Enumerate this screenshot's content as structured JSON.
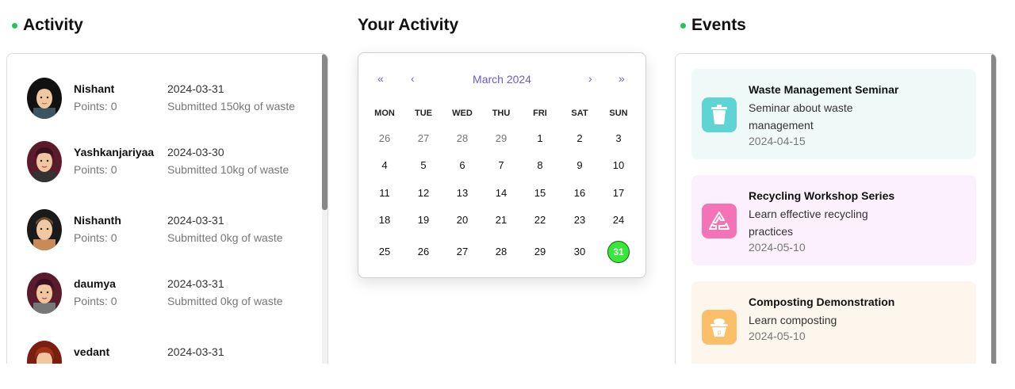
{
  "activity": {
    "title": "Activity",
    "items": [
      {
        "name": "Nishant",
        "points": "Points: 0",
        "date": "2024-03-31",
        "desc": "Submitted 150kg of waste"
      },
      {
        "name": "Yashkanjariyaa",
        "points": "Points: 0",
        "date": "2024-03-30",
        "desc": "Submitted 10kg of waste"
      },
      {
        "name": "Nishanth",
        "points": "Points: 0",
        "date": "2024-03-31",
        "desc": "Submitted 0kg of waste"
      },
      {
        "name": "daumya",
        "points": "Points: 0",
        "date": "2024-03-31",
        "desc": "Submitted 0kg of waste"
      },
      {
        "name": "vedant",
        "points": "",
        "date": "2024-03-31",
        "desc": ""
      }
    ]
  },
  "calendar": {
    "title": "Your Activity",
    "month_label": "March 2024",
    "nav": {
      "prev_year": "«",
      "prev_month": "‹",
      "next_month": "›",
      "next_year": "»"
    },
    "weekdays": [
      "MON",
      "TUE",
      "WED",
      "THU",
      "FRI",
      "SAT",
      "SUN"
    ],
    "weeks": [
      [
        "26",
        "27",
        "28",
        "29",
        "1",
        "2",
        "3"
      ],
      [
        "4",
        "5",
        "6",
        "7",
        "8",
        "9",
        "10"
      ],
      [
        "11",
        "12",
        "13",
        "14",
        "15",
        "16",
        "17"
      ],
      [
        "18",
        "19",
        "20",
        "21",
        "22",
        "23",
        "24"
      ],
      [
        "25",
        "26",
        "27",
        "28",
        "29",
        "30",
        "31"
      ]
    ],
    "selected_day": "31",
    "accent_color": "#6a5acd",
    "today_color": "#39e639"
  },
  "events": {
    "title": "Events",
    "items": [
      {
        "title": "Waste Management Seminar",
        "desc": "Seminar about waste management",
        "date": "2024-04-15",
        "icon": "trash-bin-icon",
        "bg": "#effaf8",
        "icon_bg": "#5fd4d4"
      },
      {
        "title": "Recycling Workshop Series",
        "desc": "Learn effective recycling practices",
        "date": "2024-05-10",
        "icon": "recycle-icon",
        "bg": "#fbf0fb",
        "icon_bg": "#f472b6"
      },
      {
        "title": "Composting Demonstration",
        "desc": "Learn composting",
        "date": "2024-05-10",
        "icon": "compost-pot-icon",
        "bg": "#fcf6ec",
        "icon_bg": "#fbbf6a"
      }
    ]
  }
}
